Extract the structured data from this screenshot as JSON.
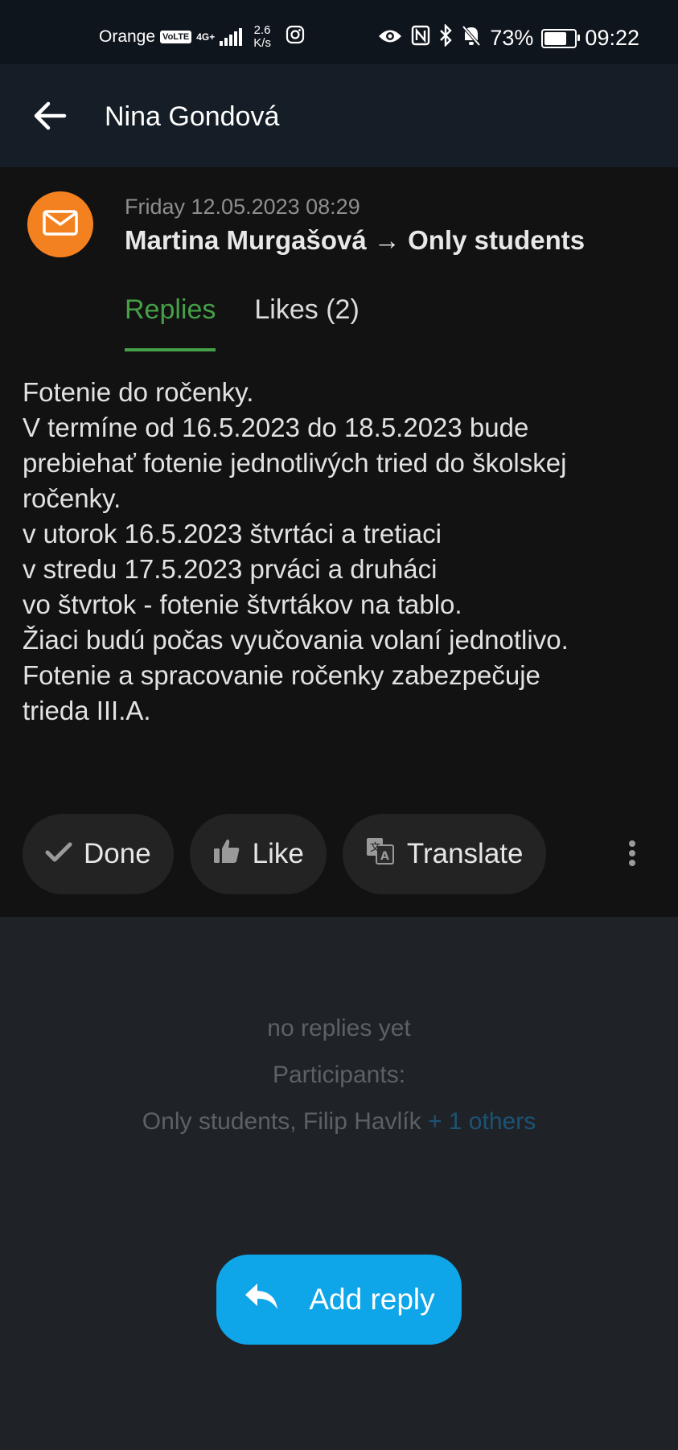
{
  "status_bar": {
    "carrier": "Orange",
    "volte": "VoLTE",
    "network": "4G+",
    "speed_value": "2.6",
    "speed_unit": "K/s",
    "battery": "73%",
    "battery_level": 0.73,
    "time": "09:22",
    "icons": [
      "instagram-icon",
      "eye-icon",
      "nfc-icon",
      "bluetooth-icon",
      "bell-off-icon"
    ]
  },
  "header": {
    "title": "Nina Gondová"
  },
  "post": {
    "date": "Friday 12.05.2023 08:29",
    "sender": "Martina Murgašová → Only students",
    "avatar_color": "#f48120",
    "tabs": [
      {
        "label": "Replies",
        "active": true
      },
      {
        "label": "Likes (2)",
        "active": false
      }
    ],
    "body_lines": [
      "Fotenie do ročenky.",
      "V termíne od 16.5.2023 do 18.5.2023 bude",
      "prebiehať fotenie jednotlivých tried do školskej",
      "ročenky.",
      "v utorok 16.5.2023 štvrtáci a tretiaci",
      "v stredu 17.5.2023 prváci a druháci",
      "vo štvrtok - fotenie štvrtákov na tablo.",
      "Žiaci budú počas vyučovania volaní jednotlivo.",
      "Fotenie a spracovanie ročenky zabezpečuje",
      "trieda III.A."
    ],
    "actions": {
      "done": "Done",
      "like": "Like",
      "translate": "Translate"
    }
  },
  "replies": {
    "empty_text": "no replies yet",
    "participants_label": "Participants:",
    "participants": "Only students, Filip Havlík",
    "others": "+ 1 others"
  },
  "reply_button": {
    "label": "Add reply",
    "color": "#0ea5e9"
  },
  "accent_green": "#45a047"
}
